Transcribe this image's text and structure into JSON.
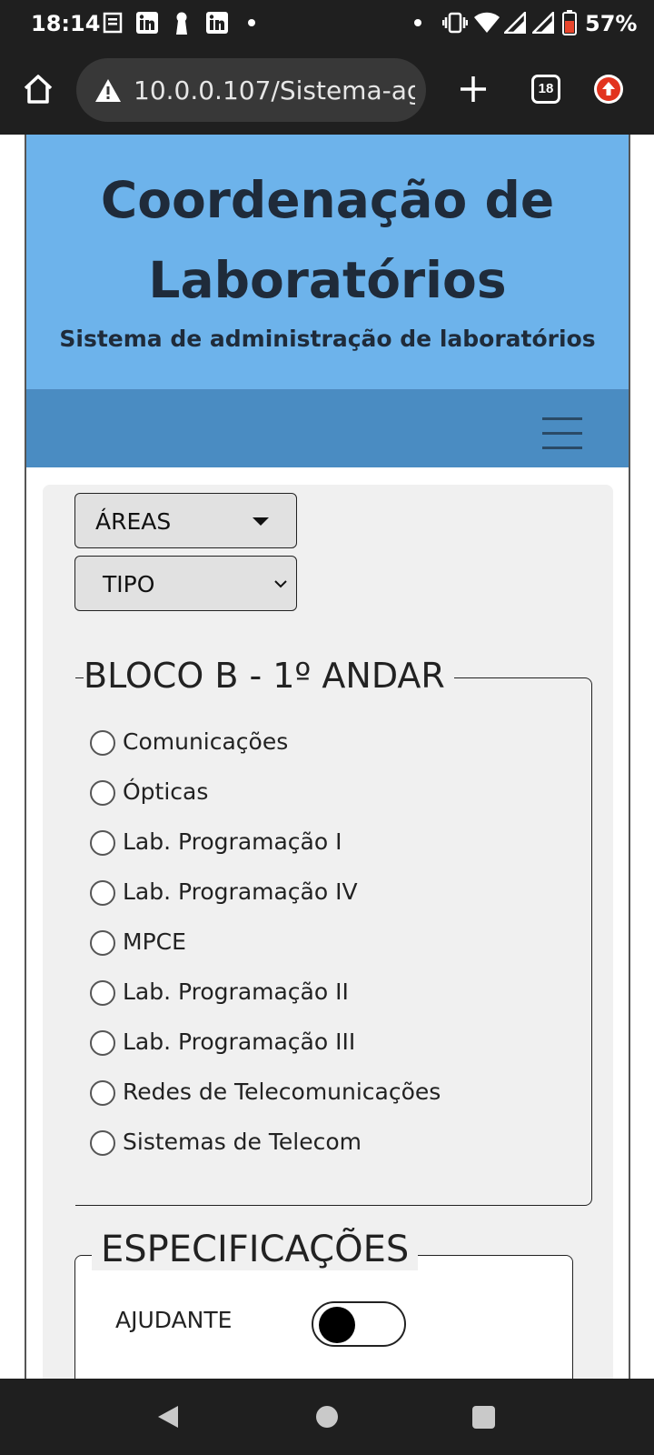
{
  "status_bar": {
    "time": "18:14",
    "battery": "57%",
    "notification_icons": [
      "news-icon",
      "linkedin-icon",
      "keyhole-icon",
      "linkedin-icon",
      "dot-icon"
    ],
    "system_icons": [
      "dot-icon",
      "vibrate-icon",
      "wifi-icon",
      "signal-icon",
      "signal-icon",
      "battery-icon"
    ]
  },
  "browser": {
    "url": "10.0.0.107/Sistema-agen",
    "tab_count": "18"
  },
  "header": {
    "title_line1": "Coordenação de",
    "title_line2": "Laboratórios",
    "subtitle": "Sistema de administração de laboratórios",
    "background_color": "#6db3eb",
    "navbar_color": "#4a8cc2"
  },
  "filters": {
    "areas_label": "ÁREAS",
    "tipo_selected": "TIPO"
  },
  "bloco": {
    "legend": "BLOCO B - 1º ANDAR",
    "options": [
      "Comunicações",
      "Ópticas",
      "Lab. Programação I",
      "Lab. Programação IV",
      "MPCE",
      "Lab. Programação II",
      "Lab. Programação III",
      "Redes de Telecomunicações",
      "Sistemas de Telecom"
    ]
  },
  "especificacoes": {
    "legend": "ESPECIFICAÇÕES",
    "ajudante_label": "AJUDANTE",
    "ajudante_on": false
  }
}
